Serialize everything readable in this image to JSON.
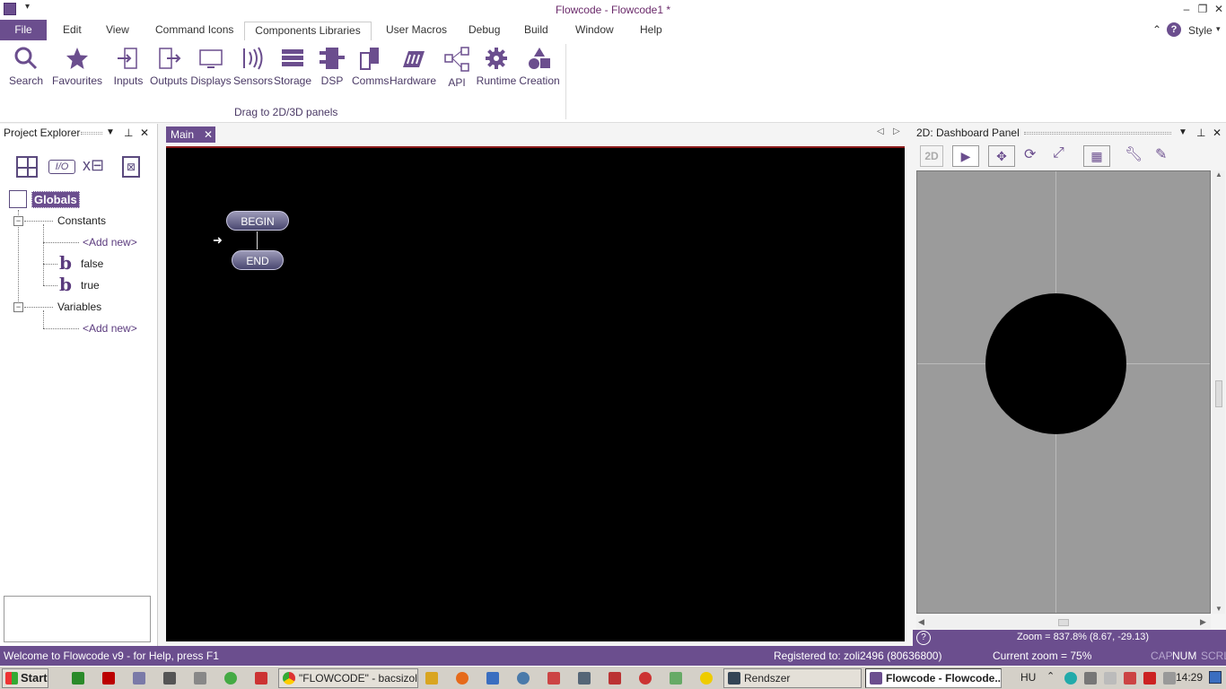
{
  "window": {
    "title": "Flowcode - Flowcode1 *"
  },
  "menu": {
    "file": "File",
    "items": [
      "Edit",
      "View",
      "Command Icons",
      "Components Libraries",
      "User Macros",
      "Debug",
      "Build",
      "Window",
      "Help"
    ],
    "style": "Style"
  },
  "ribbon": {
    "buttons": [
      "Search",
      "Favourites",
      "Inputs",
      "Outputs",
      "Displays",
      "Sensors",
      "Storage",
      "DSP",
      "Comms",
      "Hardware",
      "API",
      "Runtime",
      "Creation"
    ],
    "caption": "Drag to 2D/3D panels"
  },
  "project_explorer": {
    "title": "Project Explorer",
    "root": "Globals",
    "constants": "Constants",
    "add_new": "<Add new>",
    "const_false": "false",
    "const_true": "true",
    "variables": "Variables",
    "add_new_var": "<Add new>"
  },
  "editor": {
    "tab": "Main",
    "begin": "BEGIN",
    "end": "END"
  },
  "dashboard": {
    "title": "2D: Dashboard Panel",
    "mode_2d": "2D",
    "zoom_readout": "Zoom = 837.8% (8.67, -29.13)"
  },
  "status": {
    "welcome": "Welcome to Flowcode v9 - for Help, press F1",
    "registered": "Registered to: zoli2496 (80636800)",
    "current_zoom": "Current zoom = 75%",
    "cap": "CAP",
    "num": "NUM",
    "scrl": "SCRL"
  },
  "taskbar": {
    "start": "Start",
    "tasks": [
      "\"FLOWCODE\" - bacsizoli...",
      "Rendszer",
      "Flowcode - Flowcode..."
    ],
    "lang": "HU",
    "clock": "14:29"
  },
  "colors": {
    "accent": "#6b4e8e",
    "canvas": "#000000",
    "dash_bg": "#9b9b9b"
  }
}
